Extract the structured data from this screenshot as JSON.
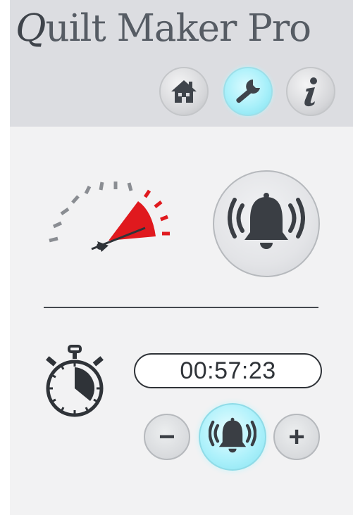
{
  "header": {
    "app_title_first": "Q",
    "app_title_rest": "uilt Maker Pro",
    "nav": [
      {
        "id": "home",
        "icon": "home-icon"
      },
      {
        "id": "settings",
        "icon": "wrench-icon",
        "active": true
      },
      {
        "id": "info",
        "icon": "info-icon"
      }
    ]
  },
  "speed_section": {
    "gauge_icon": "speedometer-icon",
    "alarm_icon": "bell-ringing-icon"
  },
  "timer_section": {
    "stopwatch_icon": "stopwatch-icon",
    "time": "00:57:23",
    "decrease_label": "−",
    "increase_label": "+",
    "alarm_icon": "bell-ringing-icon"
  },
  "colors": {
    "header_bg": "#dcdde1",
    "content_bg": "#f2f2f3",
    "accent_cyan": "#a8f0fa",
    "gauge_red": "#e0191e",
    "icon_dark": "#3a3e44"
  }
}
